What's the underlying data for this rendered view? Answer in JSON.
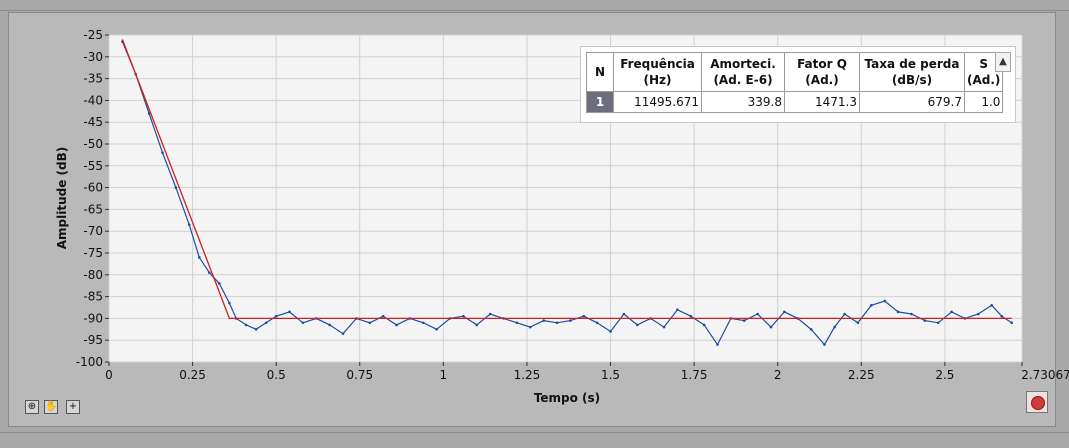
{
  "chart_data": {
    "type": "line",
    "xlabel": "Tempo (s)",
    "ylabel": "Amplitude (dB)",
    "xlim": [
      0,
      2.73067
    ],
    "ylim": [
      -100,
      -25
    ],
    "x_ticks": [
      "0",
      "0.25",
      "0.5",
      "0.75",
      "1",
      "1.25",
      "1.5",
      "1.75",
      "2",
      "2.25",
      "2.5",
      "2.73067"
    ],
    "y_ticks": [
      "-25",
      "-30",
      "-35",
      "-40",
      "-45",
      "-50",
      "-55",
      "-60",
      "-65",
      "-70",
      "-75",
      "-80",
      "-85",
      "-90",
      "-95",
      "-100"
    ],
    "grid": true,
    "series": [
      {
        "color": "#1f4e9e",
        "marker": "dot",
        "x": [
          0.04,
          0.08,
          0.12,
          0.16,
          0.2,
          0.24,
          0.27,
          0.3,
          0.33,
          0.36,
          0.38,
          0.41,
          0.44,
          0.47,
          0.5,
          0.54,
          0.58,
          0.62,
          0.66,
          0.7,
          0.74,
          0.78,
          0.82,
          0.86,
          0.9,
          0.94,
          0.98,
          1.02,
          1.06,
          1.1,
          1.14,
          1.18,
          1.22,
          1.26,
          1.3,
          1.34,
          1.38,
          1.42,
          1.46,
          1.5,
          1.54,
          1.58,
          1.62,
          1.66,
          1.7,
          1.74,
          1.78,
          1.82,
          1.86,
          1.9,
          1.94,
          1.98,
          2.02,
          2.06,
          2.1,
          2.14,
          2.17,
          2.2,
          2.24,
          2.28,
          2.32,
          2.36,
          2.4,
          2.44,
          2.48,
          2.52,
          2.56,
          2.6,
          2.64,
          2.67,
          2.7
        ],
        "y": [
          -26.5,
          -34,
          -43,
          -52,
          -60,
          -68.5,
          -76,
          -79.5,
          -82,
          -86.5,
          -90,
          -91.5,
          -92.5,
          -91,
          -89.5,
          -88.5,
          -91,
          -90,
          -91.5,
          -93.5,
          -90,
          -91,
          -89.5,
          -91.5,
          -90,
          -91,
          -92.5,
          -90,
          -89.5,
          -91.5,
          -89,
          -90,
          -91,
          -92,
          -90.5,
          -91,
          -90.5,
          -89.5,
          -91,
          -93,
          -89,
          -91.5,
          -90,
          -92,
          -88,
          -89.5,
          -91.5,
          -96,
          -90,
          -90.5,
          -89,
          -92,
          -88.5,
          -90,
          -92.5,
          -96,
          -92,
          -89,
          -91,
          -87,
          -86,
          -88.5,
          -89,
          -90.5,
          -91,
          -88.5,
          -90,
          -89,
          -87,
          -89.5,
          -91
        ]
      },
      {
        "color": "#d02020",
        "marker": "none",
        "x": [
          0.04,
          0.36,
          2.7
        ],
        "y": [
          -26,
          -90,
          -90
        ]
      }
    ],
    "table": {
      "columns": [
        "N",
        "Frequência\n(Hz)",
        "Amorteci.\n(Ad. E-6)",
        "Fator Q\n(Ad.)",
        "Taxa de perda\n(dB/s)",
        "S\n(Ad.)"
      ],
      "rows": [
        [
          "1",
          "11495.671",
          "339.8",
          "1471.3",
          "679.7",
          "1.0"
        ]
      ]
    }
  },
  "toolbar": {
    "zoom_icon": "zoom-icon",
    "pan_icon": "hand-pan-icon",
    "cursor_icon": "crosshair-icon",
    "export_icon": "export-image-icon"
  }
}
